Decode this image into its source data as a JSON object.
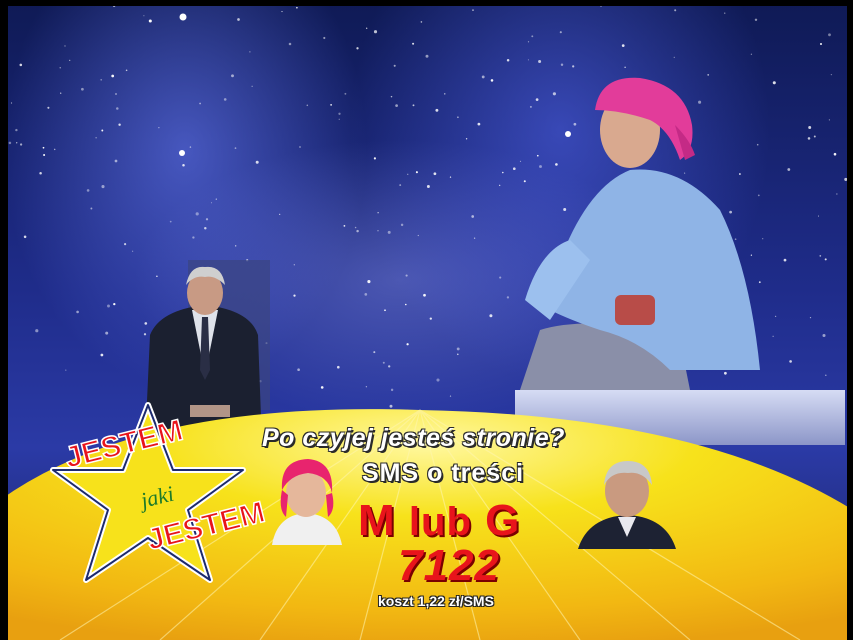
{
  "overlay": {
    "question": "Po czyjej jesteś stronie?",
    "sms_line": "SMS o treści",
    "choice_m": "M",
    "choice_or": "lub",
    "choice_g": "G",
    "sms_number": "7122",
    "cost": "koszt 1,22 zł/SMS"
  },
  "logo": {
    "line1": "JESTEM",
    "middle": "jaki",
    "line2": "JESTEM"
  },
  "colors": {
    "accent_red": "#e8141b",
    "banner_yellow": "#f7e21b",
    "backdrop_blue": "#2b3aa6"
  }
}
